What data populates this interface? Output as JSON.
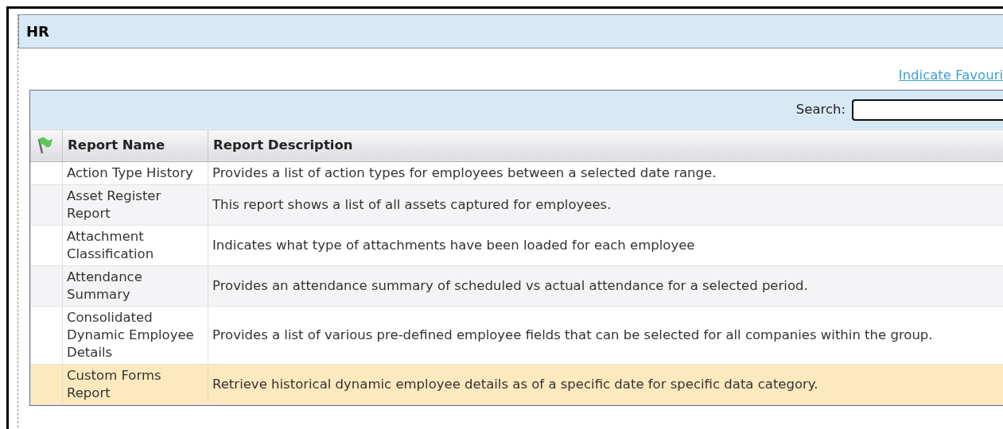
{
  "panel": {
    "title": "HR"
  },
  "favourites_link": "Indicate Favouri",
  "search": {
    "label": "Search:"
  },
  "table": {
    "columns": [
      "Report Name",
      "Report Description"
    ],
    "rows": [
      {
        "name": "Action Type History",
        "description": "Provides a list of action types for employees between a selected date range.",
        "selected": false
      },
      {
        "name": "Asset Register Report",
        "description": "This report shows a list of all assets captured for employees.",
        "selected": false
      },
      {
        "name": "Attachment Classification",
        "description": "Indicates what type of attachments have been loaded for each employee",
        "selected": false
      },
      {
        "name": "Attendance Summary",
        "description": "Provides an attendance summary of scheduled vs actual attendance for a selected period.",
        "selected": false
      },
      {
        "name": "Consolidated Dynamic Employee Details",
        "description": "Provides a list of various pre-defined employee fields that can be selected for all companies within the group.",
        "selected": false
      },
      {
        "name": "Custom Forms Report",
        "description": "Retrieve historical dynamic employee details as of a specific date for specific data category.",
        "selected": true
      }
    ]
  }
}
